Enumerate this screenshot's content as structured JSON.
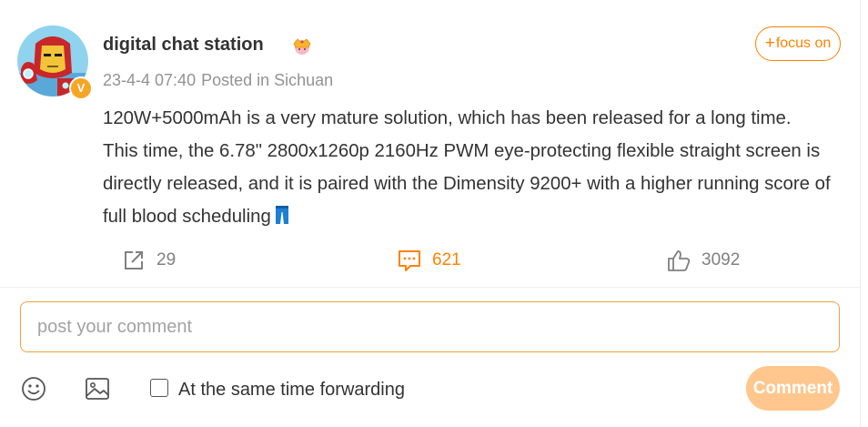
{
  "post": {
    "username": "digital chat station",
    "badge_letter": "V",
    "timestamp": "23-4-4 07:40",
    "location": "Posted in Sichuan",
    "follow_label": "focus on",
    "content": "120W+5000mAh is a very mature solution, which has been released for a long time. This time, the 6.78\" 2800x1260p 2160Hz PWM eye-protecting flexible straight screen is directly released, and it is paired with the Dimensity 9200+ with a higher running score of full blood scheduling",
    "actions": {
      "repost_count": "29",
      "comment_count": "621",
      "like_count": "3092"
    }
  },
  "composer": {
    "placeholder": "post your comment",
    "forward_label": "At the same time forwarding",
    "submit_label": "Comment"
  },
  "colors": {
    "accent": "#ff8200",
    "input_border": "#f2a23e",
    "submit_bg": "#ffc78e",
    "muted_text": "#939393"
  },
  "icons": [
    "avatar-image",
    "crown-icon",
    "repost-icon",
    "comment-icon",
    "like-icon",
    "emoji-icon",
    "image-icon",
    "jeans-emoji-icon"
  ]
}
